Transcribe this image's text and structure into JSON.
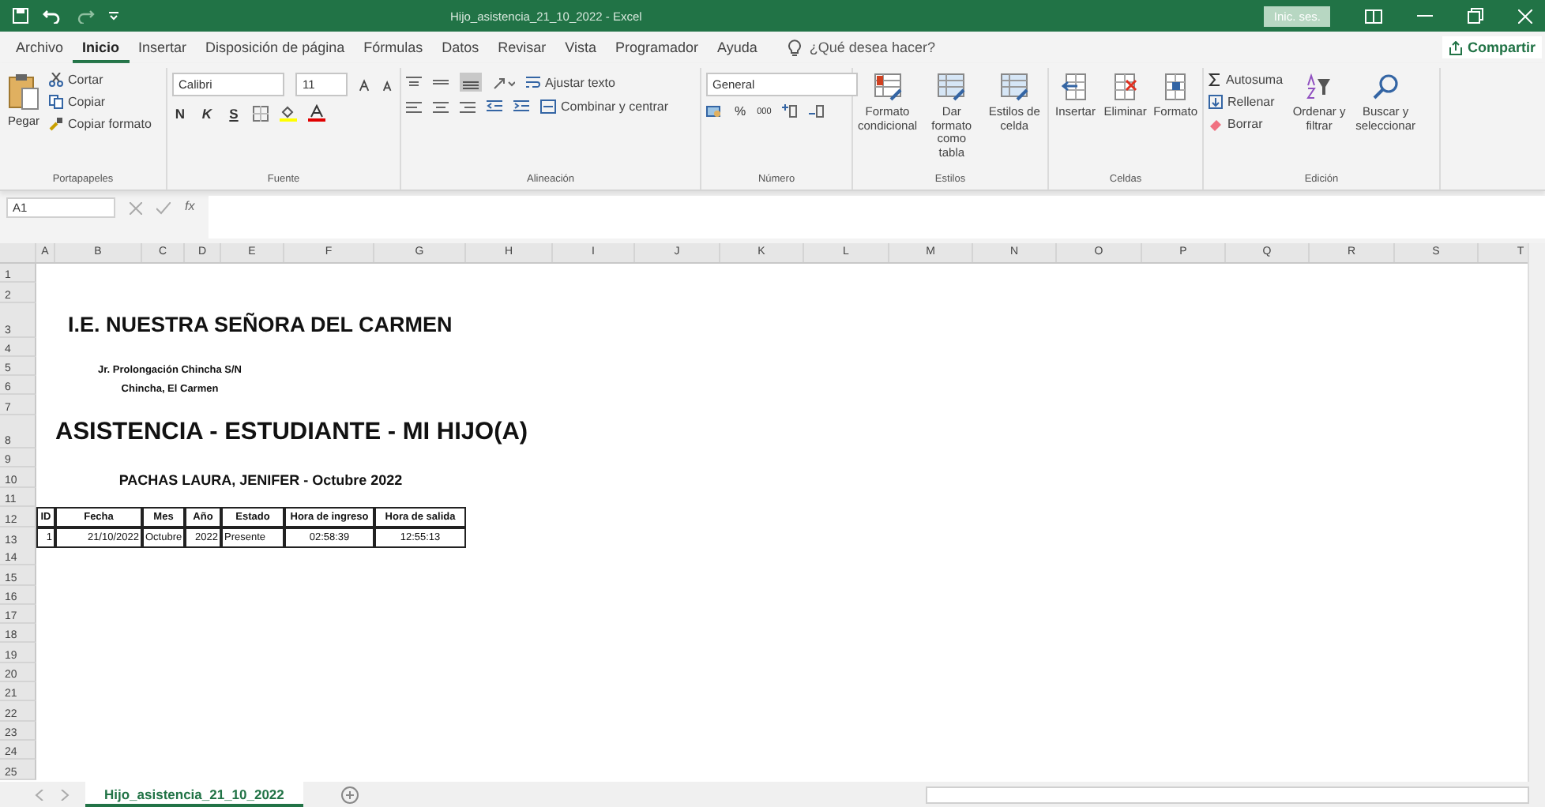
{
  "window": {
    "title": "Hijo_asistencia_21_10_2022  -  Excel",
    "sign_in": "Inic. ses."
  },
  "menu_tabs": [
    {
      "label": "Archivo",
      "selected": false
    },
    {
      "label": "Inicio",
      "selected": true
    },
    {
      "label": "Insertar",
      "selected": false
    },
    {
      "label": "Disposición de página",
      "selected": false
    },
    {
      "label": "Fórmulas",
      "selected": false
    },
    {
      "label": "Datos",
      "selected": false
    },
    {
      "label": "Revisar",
      "selected": false
    },
    {
      "label": "Vista",
      "selected": false
    },
    {
      "label": "Programador",
      "selected": false
    },
    {
      "label": "Ayuda",
      "selected": false
    }
  ],
  "tell_me": {
    "placeholder": "¿Qué desea hacer?"
  },
  "share": "Compartir",
  "ribbon": {
    "clipboard": {
      "label": "Portapapeles",
      "paste": "Pegar",
      "cut": "Cortar",
      "copy": "Copiar",
      "format_painter": "Copiar formato"
    },
    "font": {
      "label": "Fuente",
      "family": "Calibri",
      "size": "11",
      "bold": "N",
      "italic": "K",
      "underline": "S"
    },
    "alignment": {
      "label": "Alineación",
      "wrap": "Ajustar texto",
      "merge": "Combinar y centrar"
    },
    "number": {
      "label": "Número",
      "format": "General",
      "percent": "%",
      "thousands": "000"
    },
    "styles": {
      "label": "Estilos",
      "items": [
        "Formato condicional",
        "Dar formato como tabla",
        "Estilos de celda"
      ]
    },
    "cells": {
      "label": "Celdas",
      "items": [
        "Insertar",
        "Eliminar",
        "Formato"
      ]
    },
    "editing": {
      "label": "Edición",
      "autosum": "Autosuma",
      "fill": "Rellenar",
      "clear": "Borrar",
      "sort": "Ordenar y filtrar",
      "find": "Buscar y seleccionar"
    }
  },
  "formula_bar": {
    "name_box": "A1",
    "fx": "fx"
  },
  "sheet": {
    "columns": [
      "A",
      "B",
      "C",
      "D",
      "E",
      "F",
      "G",
      "H",
      "I",
      "J",
      "K",
      "L",
      "M",
      "N",
      "O",
      "P",
      "Q",
      "R",
      "S",
      "T"
    ],
    "rows": [
      {
        "number": "1"
      },
      {
        "number": "2"
      },
      {
        "number": "3",
        "kind": "title",
        "text": "I.E. NUESTRA SEÑORA DEL CARMEN"
      },
      {
        "number": "4"
      },
      {
        "number": "5",
        "kind": "subtitle",
        "text": "Jr. Prolongación Chincha S/N"
      },
      {
        "number": "6",
        "kind": "subtitle",
        "text": "Chincha, El Carmen"
      },
      {
        "number": "7"
      },
      {
        "number": "8",
        "kind": "heading",
        "text": "ASISTENCIA - ESTUDIANTE - MI HIJO(A)"
      },
      {
        "number": "9"
      },
      {
        "number": "10",
        "kind": "caption",
        "text": "PACHAS LAURA, JENIFER - Octubre 2022"
      },
      {
        "number": "11"
      },
      {
        "number": "12",
        "kind": "table-header",
        "cells": [
          "ID",
          "Fecha",
          "Mes",
          "Año",
          "Estado",
          "Hora de ingreso",
          "Hora de salida"
        ]
      },
      {
        "number": "13",
        "kind": "table-row",
        "cells": [
          "1",
          "21/10/2022",
          "Octubre",
          "2022",
          "Presente",
          "02:58:39",
          "12:55:13"
        ]
      },
      {
        "number": "14"
      },
      {
        "number": "15"
      },
      {
        "number": "16"
      },
      {
        "number": "17"
      },
      {
        "number": "18"
      },
      {
        "number": "19"
      },
      {
        "number": "20"
      },
      {
        "number": "21"
      },
      {
        "number": "22"
      },
      {
        "number": "23"
      },
      {
        "number": "24"
      },
      {
        "number": "25"
      }
    ]
  },
  "sheet_tabs": [
    {
      "label": "Hijo_asistencia_21_10_2022",
      "selected": true
    }
  ]
}
